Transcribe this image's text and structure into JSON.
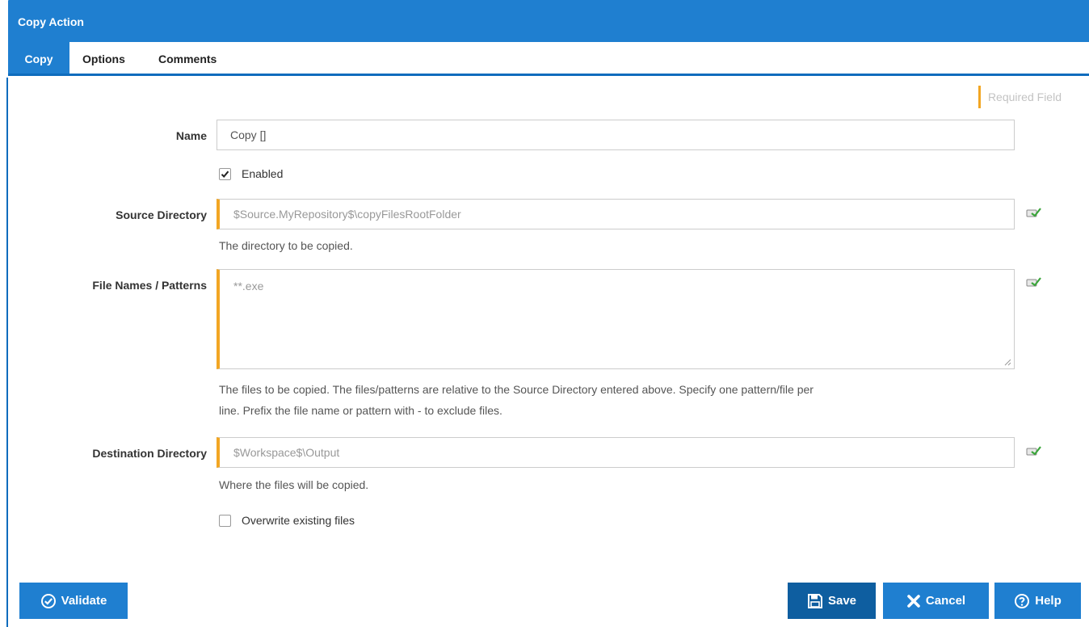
{
  "window": {
    "title": "Copy Action"
  },
  "tabs": [
    {
      "label": "Copy",
      "active": true
    },
    {
      "label": "Options",
      "active": false
    },
    {
      "label": "Comments",
      "active": false
    }
  ],
  "legend": {
    "required_label": "Required Field"
  },
  "fields": {
    "name": {
      "label": "Name",
      "value": "Copy []"
    },
    "enabled": {
      "label": "Enabled",
      "checked": true
    },
    "source_directory": {
      "label": "Source Directory",
      "value": "$Source.MyRepository$\\copyFilesRootFolder",
      "help": "The directory to be copied."
    },
    "file_patterns": {
      "label": "File Names / Patterns",
      "value": "**.exe",
      "help_line1": "The files to be copied. The files/patterns are relative to the Source Directory entered above. Specify one pattern/file per",
      "help_line2": "line. Prefix the file name or pattern with - to exclude files."
    },
    "destination_directory": {
      "label": "Destination Directory",
      "value": "$Workspace$\\Output",
      "help": "Where the files will be copied."
    },
    "overwrite": {
      "label": "Overwrite existing files",
      "checked": false
    }
  },
  "buttons": {
    "validate": "Validate",
    "save": "Save",
    "cancel": "Cancel",
    "help": "Help"
  },
  "colors": {
    "accent": "#1f7fd0",
    "accent_dark": "#0e5ea0",
    "required": "#f2a623"
  }
}
